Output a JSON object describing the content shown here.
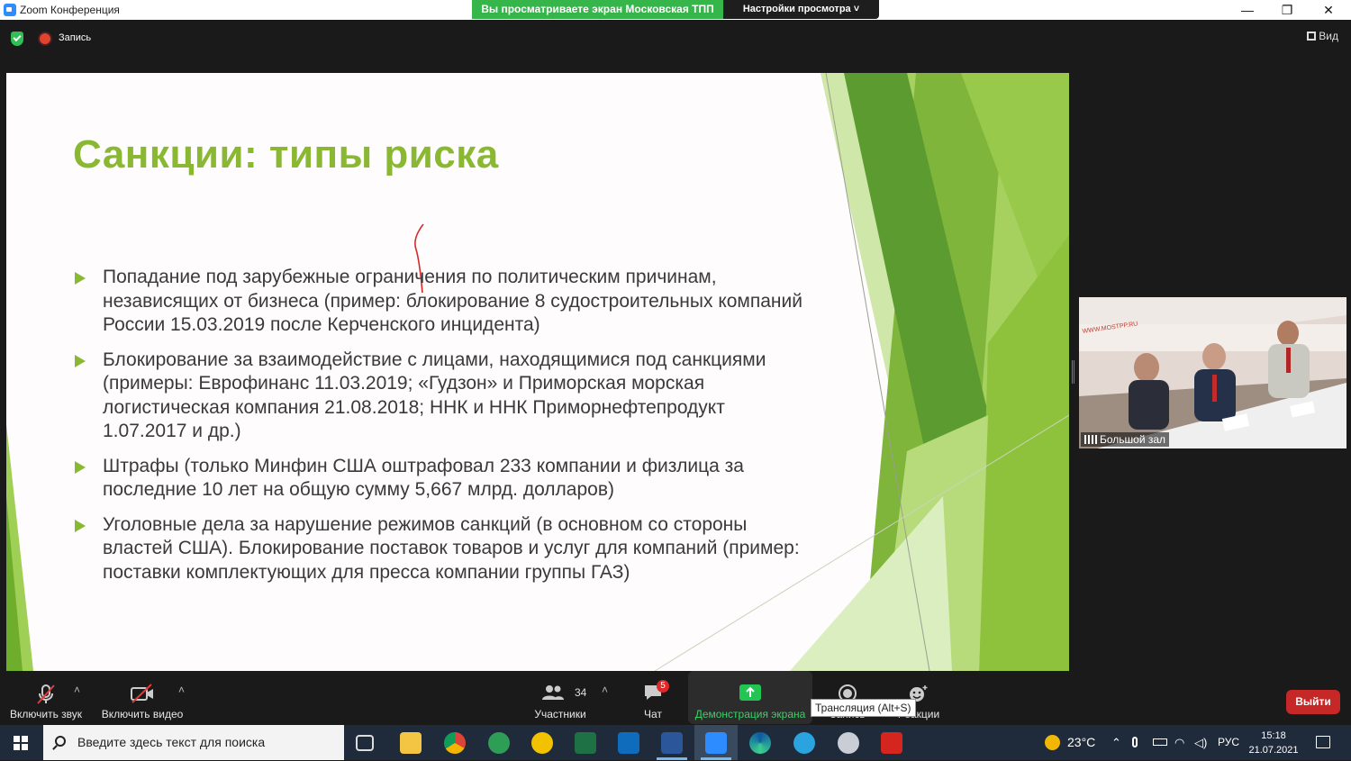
{
  "window": {
    "title": "Zoom Конференция",
    "share_banner": "Вы просматриваете экран Московская ТПП",
    "view_settings": "Настройки просмотра ˅",
    "minimize": "—",
    "maximize": "❐",
    "close": "✕"
  },
  "topbar": {
    "recording_label": "Запись",
    "view_label": "Вид"
  },
  "slide": {
    "title": "Санкции: типы риска",
    "bullets": [
      "Попадание под зарубежные ограничения по политическим причинам, независящих от бизнеса (пример: блокирование 8 судостроительных компаний России 15.03.2019 после Керченского инцидента)",
      "Блокирование за взаимодействие с лицами, находящимися под санкциями (примеры: Еврофинанс 11.03.2019; «Гудзон» и Приморская морская логистическая компания 21.08.2018; ННК и ННК Приморнефтепродукт 1.07.2017 и др.)",
      "Штрафы (только Минфин США оштрафовал 233 компании и физлица за последние 10 лет на общую сумму 5,667 млрд. долларов)",
      "Уголовные дела за нарушение режимов санкций (в основном со стороны властей США). Блокирование поставок товаров и услуг для компаний (пример: поставки комплектующих для пресса компании группы ГАЗ)"
    ],
    "colors": {
      "accent": "#8ab833",
      "text": "#3a3a3a",
      "dark_green": "#4e8a2a"
    }
  },
  "gallery": {
    "participant_name": "Большой зал",
    "wall_text": "WWW.MOSTPP.RU"
  },
  "toolbar": {
    "audio_label": "Включить звук",
    "video_label": "Включить видео",
    "participants_label": "Участники",
    "participants_count": "34",
    "chat_label": "Чат",
    "chat_badge": "5",
    "share_label": "Демонстрация экрана",
    "record_label": "Запись",
    "reactions_label": "Реакции",
    "tooltip": "Трансляция (Alt+S)",
    "exit_label": "Выйти",
    "caret": "˄"
  },
  "taskbar": {
    "search_placeholder": "Введите здесь текст для поиска",
    "weather": "23°C",
    "language": "РУС",
    "time": "15:18",
    "date": "21.07.2021"
  }
}
